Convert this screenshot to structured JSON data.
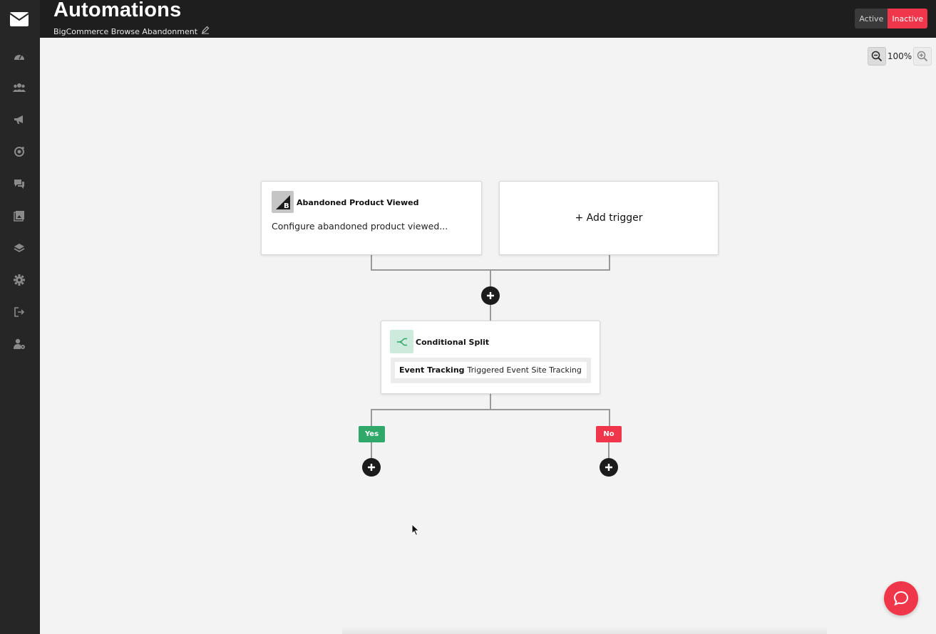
{
  "header": {
    "title": "Automations",
    "subtitle": "BigCommerce Browse Abandonment",
    "toggle": {
      "active_label": "Active",
      "inactive_label": "Inactive",
      "selected": "Inactive"
    }
  },
  "sidebar": {
    "items": [
      {
        "icon": "dashboard-icon"
      },
      {
        "icon": "contacts-icon"
      },
      {
        "icon": "campaigns-megaphone-icon"
      },
      {
        "icon": "automations-icon"
      },
      {
        "icon": "conversations-icon"
      },
      {
        "icon": "media-gallery-icon"
      },
      {
        "icon": "integrations-layers-icon"
      },
      {
        "icon": "settings-gear-icon"
      },
      {
        "icon": "logout-icon"
      },
      {
        "icon": "account-settings-icon"
      }
    ]
  },
  "zoom": {
    "level": "100%"
  },
  "workflow": {
    "trigger": {
      "title": "Abandoned Product Viewed",
      "description": "Configure abandoned product viewed..."
    },
    "add_trigger": "+ Add trigger",
    "split": {
      "title": "Conditional Split",
      "condition_bold": "Event Tracking",
      "condition_text": "Triggered Event Site Tracking"
    },
    "branches": {
      "yes": "Yes",
      "no": "No"
    }
  },
  "colors": {
    "accent_red": "#f0364a",
    "yes_green": "#2fa86a",
    "sidebar": "#262626",
    "header": "#1e1e1e"
  }
}
